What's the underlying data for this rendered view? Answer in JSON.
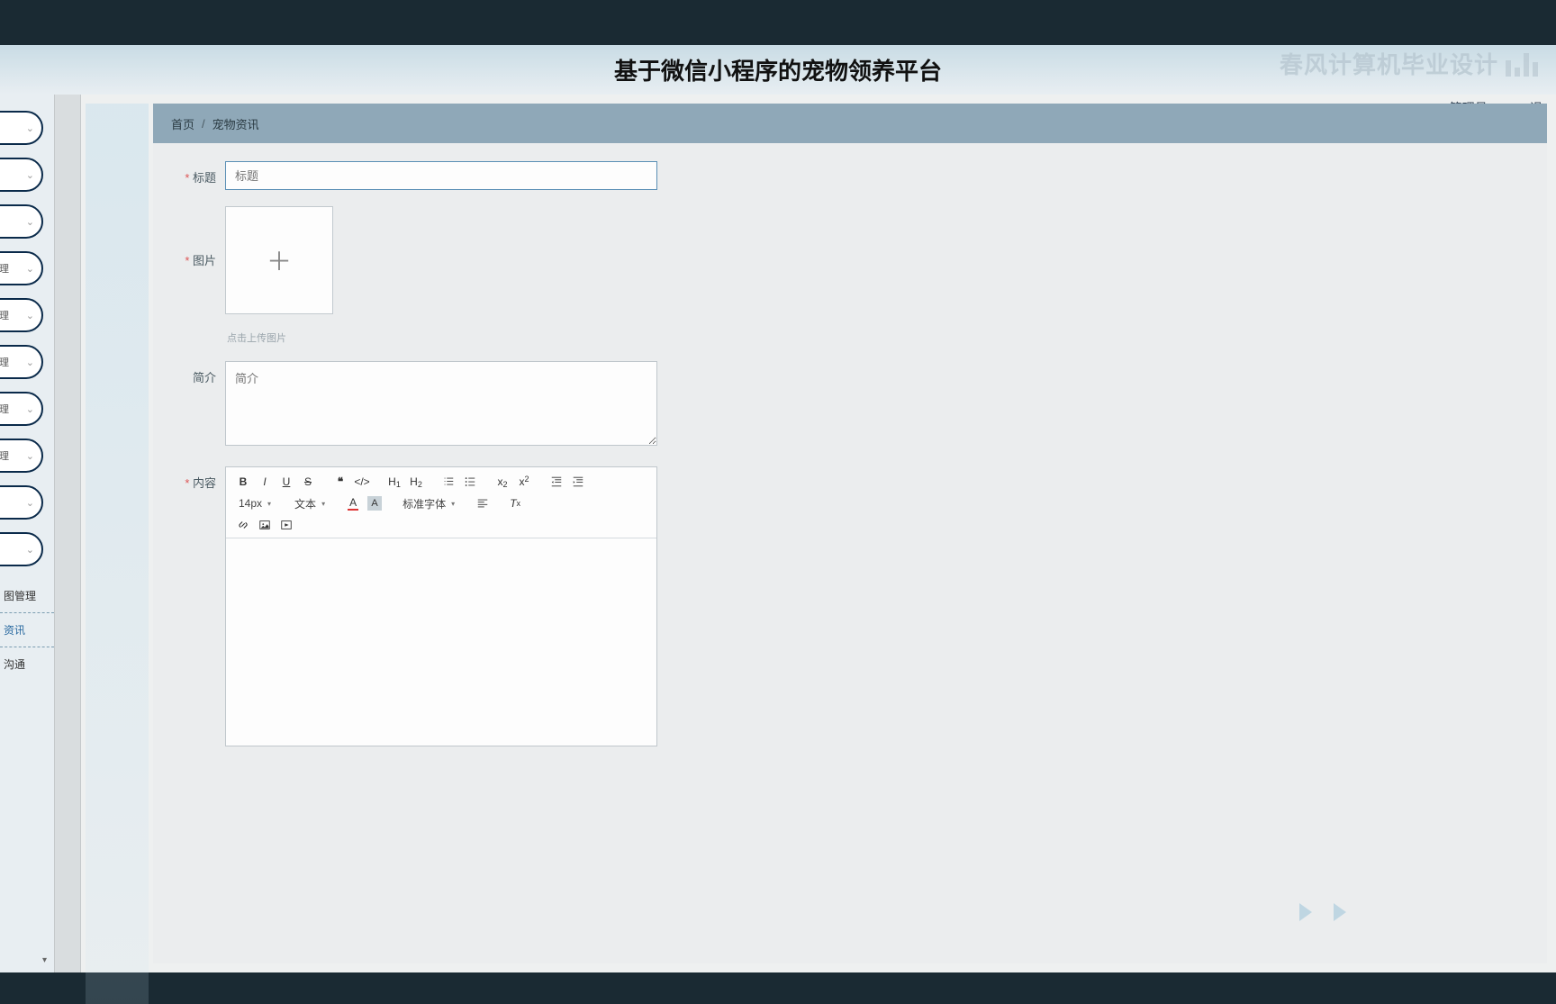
{
  "watermark_text": "春风计算机毕业设计",
  "app_title": "基于微信小程序的宠物领养平台",
  "user": {
    "role_label": "管理员 abo",
    "logout_label": "退"
  },
  "sidebar": {
    "pills": [
      {
        "label": ""
      },
      {
        "label": ""
      },
      {
        "label": ""
      },
      {
        "label": "管理"
      },
      {
        "label": "管理"
      },
      {
        "label": "管理"
      },
      {
        "label": "管理"
      },
      {
        "label": "管理"
      },
      {
        "label": ""
      },
      {
        "label": ""
      }
    ],
    "flats": [
      {
        "label": "图管理"
      },
      {
        "label": "资讯"
      },
      {
        "label": "沟通"
      }
    ]
  },
  "breadcrumb": {
    "home": "首页",
    "sep": "/",
    "current": "宠物资讯"
  },
  "form": {
    "title": {
      "label": "标题",
      "placeholder": "标题"
    },
    "image": {
      "label": "图片",
      "hint": "点击上传图片"
    },
    "intro": {
      "label": "简介",
      "placeholder": "简介"
    },
    "content": {
      "label": "内容"
    }
  },
  "editor": {
    "font_size": "14px",
    "text_type": "文本",
    "font_family": "标准字体"
  }
}
